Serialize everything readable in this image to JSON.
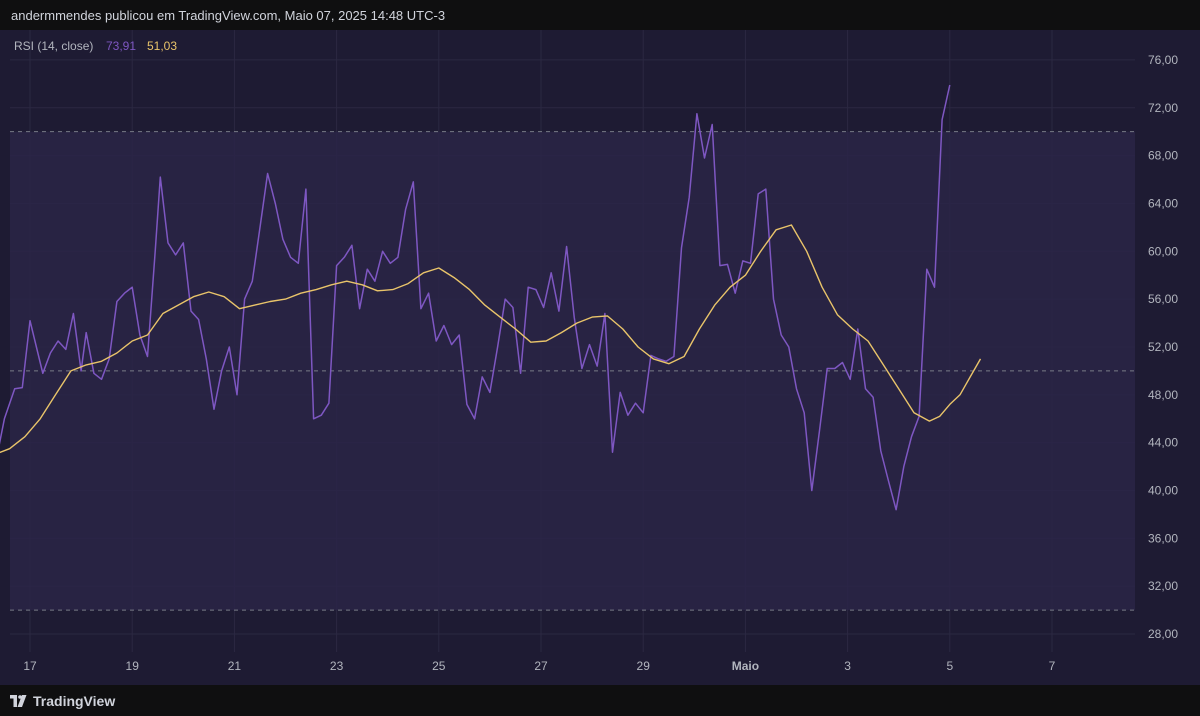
{
  "header": {
    "credit": "andermmendes publicou em TradingView.com, Maio 07, 2025 14:48 UTC-3"
  },
  "footer": {
    "brand": "TradingView",
    "logo_icon": "tradingview-logo-icon"
  },
  "colors": {
    "background": "#1e1b33",
    "rsi_band_fill": "#2a2447",
    "rsi_line": "#7e57c2",
    "ma_line": "#e9c46a",
    "grid": "#2b2842",
    "band_line": "#787b86",
    "axis_text": "#b2b5be"
  },
  "chart_data": {
    "type": "line",
    "legend": {
      "name": "RSI (14, close)",
      "rsi_value": "73,91",
      "ma_value": "51,03"
    },
    "ylim": [
      26.5,
      78.5
    ],
    "y_ticks": [
      28,
      32,
      36,
      40,
      44,
      48,
      52,
      56,
      60,
      64,
      68,
      72,
      76
    ],
    "y_tick_labels": [
      "28,00",
      "32,00",
      "36,00",
      "40,00",
      "44,00",
      "48,00",
      "52,00",
      "56,00",
      "60,00",
      "64,00",
      "68,00",
      "72,00",
      "76,00"
    ],
    "bands": {
      "upper": 70,
      "middle": 50,
      "lower": 30
    },
    "x_ticks": [
      {
        "day": 17,
        "label": "17"
      },
      {
        "day": 19,
        "label": "19"
      },
      {
        "day": 21,
        "label": "21"
      },
      {
        "day": 23,
        "label": "23"
      },
      {
        "day": 25,
        "label": "25"
      },
      {
        "day": 27,
        "label": "27"
      },
      {
        "day": 29,
        "label": "29"
      },
      {
        "day": 31,
        "label": "Maio"
      },
      {
        "day": 33,
        "label": "3"
      },
      {
        "day": 35,
        "label": "5"
      },
      {
        "day": 37,
        "label": "7"
      }
    ],
    "x_range": [
      16.3,
      39.0
    ],
    "grid": true,
    "series": [
      {
        "key": "rsi",
        "points": [
          [
            16.3,
            49.5
          ],
          [
            16.35,
            42.8
          ],
          [
            16.5,
            46
          ],
          [
            16.7,
            48.5
          ],
          [
            16.85,
            48.6
          ],
          [
            17.0,
            54.2
          ],
          [
            17.25,
            49.8
          ],
          [
            17.4,
            51.5
          ],
          [
            17.55,
            52.5
          ],
          [
            17.7,
            51.8
          ],
          [
            17.85,
            54.8
          ],
          [
            18.0,
            50
          ],
          [
            18.1,
            53.2
          ],
          [
            18.25,
            49.8
          ],
          [
            18.4,
            49.3
          ],
          [
            18.55,
            51
          ],
          [
            18.7,
            55.8
          ],
          [
            18.85,
            56.5
          ],
          [
            19.0,
            57
          ],
          [
            19.15,
            53
          ],
          [
            19.3,
            51.2
          ],
          [
            19.45,
            60
          ],
          [
            19.55,
            66.2
          ],
          [
            19.7,
            60.7
          ],
          [
            19.85,
            59.7
          ],
          [
            20.0,
            60.7
          ],
          [
            20.15,
            55
          ],
          [
            20.3,
            54.3
          ],
          [
            20.45,
            51
          ],
          [
            20.6,
            46.8
          ],
          [
            20.75,
            50
          ],
          [
            20.9,
            52
          ],
          [
            21.05,
            48
          ],
          [
            21.2,
            56
          ],
          [
            21.35,
            57.5
          ],
          [
            21.5,
            62
          ],
          [
            21.65,
            66.5
          ],
          [
            21.8,
            64
          ],
          [
            21.95,
            61
          ],
          [
            22.1,
            59.5
          ],
          [
            22.25,
            59
          ],
          [
            22.4,
            65.2
          ],
          [
            22.55,
            46
          ],
          [
            22.7,
            46.3
          ],
          [
            22.85,
            47.3
          ],
          [
            23.0,
            58.8
          ],
          [
            23.15,
            59.5
          ],
          [
            23.3,
            60.5
          ],
          [
            23.45,
            55.2
          ],
          [
            23.6,
            58.5
          ],
          [
            23.75,
            57.5
          ],
          [
            23.9,
            60
          ],
          [
            24.05,
            59
          ],
          [
            24.2,
            59.5
          ],
          [
            24.35,
            63.5
          ],
          [
            24.5,
            65.8
          ],
          [
            24.65,
            55.2
          ],
          [
            24.8,
            56.5
          ],
          [
            24.95,
            52.5
          ],
          [
            25.1,
            53.8
          ],
          [
            25.25,
            52.2
          ],
          [
            25.4,
            53
          ],
          [
            25.55,
            47.2
          ],
          [
            25.7,
            46
          ],
          [
            25.85,
            49.5
          ],
          [
            26.0,
            48.2
          ],
          [
            26.15,
            52
          ],
          [
            26.3,
            56
          ],
          [
            26.45,
            55.3
          ],
          [
            26.6,
            49.8
          ],
          [
            26.75,
            57
          ],
          [
            26.9,
            56.8
          ],
          [
            27.05,
            55.3
          ],
          [
            27.2,
            58.2
          ],
          [
            27.35,
            55
          ],
          [
            27.5,
            60.4
          ],
          [
            27.65,
            54.5
          ],
          [
            27.8,
            50.2
          ],
          [
            27.95,
            52.2
          ],
          [
            28.1,
            50.4
          ],
          [
            28.25,
            54.8
          ],
          [
            28.4,
            43.2
          ],
          [
            28.55,
            48.2
          ],
          [
            28.7,
            46.3
          ],
          [
            28.85,
            47.3
          ],
          [
            29.0,
            46.5
          ],
          [
            29.15,
            51.3
          ],
          [
            29.3,
            51
          ],
          [
            29.45,
            50.8
          ],
          [
            29.6,
            51.2
          ],
          [
            29.75,
            60.3
          ],
          [
            29.9,
            64.5
          ],
          [
            30.05,
            71.5
          ],
          [
            30.2,
            67.8
          ],
          [
            30.35,
            70.6
          ],
          [
            30.5,
            58.8
          ],
          [
            30.65,
            58.9
          ],
          [
            30.8,
            56.5
          ],
          [
            30.95,
            59.2
          ],
          [
            31.1,
            59
          ],
          [
            31.25,
            64.8
          ],
          [
            31.4,
            65.2
          ],
          [
            31.55,
            56
          ],
          [
            31.7,
            53
          ],
          [
            31.85,
            52
          ],
          [
            32.0,
            48.5
          ],
          [
            32.15,
            46.5
          ],
          [
            32.3,
            40
          ],
          [
            32.45,
            45
          ],
          [
            32.6,
            50.2
          ],
          [
            32.75,
            50.2
          ],
          [
            32.9,
            50.7
          ],
          [
            33.05,
            49.3
          ],
          [
            33.2,
            53.5
          ],
          [
            33.35,
            48.5
          ],
          [
            33.5,
            47.8
          ],
          [
            33.65,
            43.3
          ],
          [
            33.8,
            40.8
          ],
          [
            33.95,
            38.4
          ],
          [
            34.1,
            42
          ],
          [
            34.25,
            44.5
          ],
          [
            34.4,
            46.2
          ],
          [
            34.55,
            58.5
          ],
          [
            34.7,
            57
          ],
          [
            34.85,
            71
          ],
          [
            35.0,
            73.9
          ]
        ]
      },
      {
        "key": "ma",
        "points": [
          [
            16.3,
            43
          ],
          [
            16.6,
            43.5
          ],
          [
            16.9,
            44.5
          ],
          [
            17.2,
            46
          ],
          [
            17.5,
            48
          ],
          [
            17.8,
            50
          ],
          [
            18.1,
            50.5
          ],
          [
            18.4,
            50.8
          ],
          [
            18.7,
            51.5
          ],
          [
            19.0,
            52.5
          ],
          [
            19.3,
            53
          ],
          [
            19.6,
            54.8
          ],
          [
            19.9,
            55.5
          ],
          [
            20.2,
            56.2
          ],
          [
            20.5,
            56.6
          ],
          [
            20.8,
            56.2
          ],
          [
            21.1,
            55.2
          ],
          [
            21.4,
            55.5
          ],
          [
            21.7,
            55.8
          ],
          [
            22.0,
            56
          ],
          [
            22.3,
            56.5
          ],
          [
            22.6,
            56.8
          ],
          [
            22.9,
            57.2
          ],
          [
            23.2,
            57.5
          ],
          [
            23.5,
            57.2
          ],
          [
            23.8,
            56.7
          ],
          [
            24.1,
            56.8
          ],
          [
            24.4,
            57.3
          ],
          [
            24.7,
            58.2
          ],
          [
            25.0,
            58.6
          ],
          [
            25.3,
            57.8
          ],
          [
            25.6,
            56.8
          ],
          [
            25.9,
            55.5
          ],
          [
            26.2,
            54.5
          ],
          [
            26.5,
            53.5
          ],
          [
            26.8,
            52.4
          ],
          [
            27.1,
            52.5
          ],
          [
            27.4,
            53.2
          ],
          [
            27.7,
            54
          ],
          [
            28.0,
            54.5
          ],
          [
            28.3,
            54.6
          ],
          [
            28.6,
            53.5
          ],
          [
            28.9,
            52
          ],
          [
            29.2,
            51
          ],
          [
            29.5,
            50.6
          ],
          [
            29.8,
            51.2
          ],
          [
            30.1,
            53.5
          ],
          [
            30.4,
            55.5
          ],
          [
            30.7,
            57
          ],
          [
            31.0,
            58
          ],
          [
            31.3,
            60
          ],
          [
            31.6,
            61.8
          ],
          [
            31.9,
            62.2
          ],
          [
            32.2,
            60
          ],
          [
            32.5,
            57
          ],
          [
            32.8,
            54.7
          ],
          [
            33.1,
            53.5
          ],
          [
            33.4,
            52.5
          ],
          [
            33.7,
            50.5
          ],
          [
            34.0,
            48.5
          ],
          [
            34.3,
            46.5
          ],
          [
            34.6,
            45.8
          ],
          [
            34.8,
            46.2
          ],
          [
            35.0,
            47.2
          ],
          [
            35.2,
            48
          ],
          [
            35.4,
            49.5
          ],
          [
            35.6,
            51
          ]
        ]
      }
    ]
  }
}
